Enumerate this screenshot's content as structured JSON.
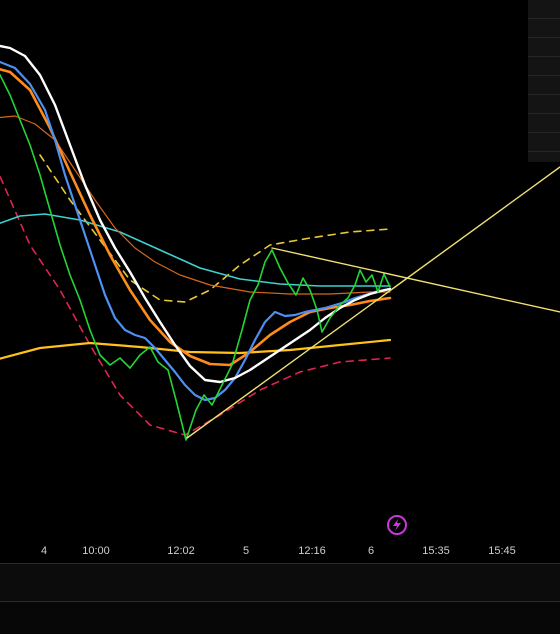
{
  "chart_data": {
    "type": "line",
    "x_tick_labels": [
      "4",
      "10:00",
      "12:02",
      "5",
      "12:16",
      "6",
      "15:35",
      "15:45"
    ],
    "colors": {
      "background": "#000000",
      "price": "#22d636",
      "fast_ma": "#4d8ff2",
      "ma_orange": "#ff8c1a",
      "ma_white": "#ffffff",
      "ma_cyan": "#3fd0d0",
      "ma_thin_orange": "#d8661a",
      "ma_yellow": "#ffc21a",
      "band_upper": "#e6c832",
      "band_lower": "#e02450",
      "trendline": "#f0e070"
    },
    "series": [
      {
        "key": "band_lower",
        "style": "dashed",
        "points": [
          [
            -5,
            165
          ],
          [
            30,
            245
          ],
          [
            60,
            290
          ],
          [
            90,
            345
          ],
          [
            120,
            395
          ],
          [
            150,
            425
          ],
          [
            185,
            435
          ],
          [
            220,
            415
          ],
          [
            260,
            390
          ],
          [
            300,
            372
          ],
          [
            340,
            362
          ],
          [
            390,
            358
          ]
        ]
      },
      {
        "key": "band_upper",
        "style": "dashed",
        "points": [
          [
            40,
            155
          ],
          [
            70,
            200
          ],
          [
            100,
            240
          ],
          [
            130,
            280
          ],
          [
            160,
            300
          ],
          [
            185,
            302
          ],
          [
            210,
            290
          ],
          [
            240,
            265
          ],
          [
            270,
            245
          ],
          [
            310,
            238
          ],
          [
            350,
            232
          ],
          [
            390,
            229
          ]
        ]
      },
      {
        "key": "ma_cyan",
        "style": "solid",
        "points": [
          [
            -5,
            225
          ],
          [
            20,
            216
          ],
          [
            45,
            214
          ],
          [
            80,
            220
          ],
          [
            120,
            232
          ],
          [
            160,
            250
          ],
          [
            200,
            268
          ],
          [
            240,
            279
          ],
          [
            280,
            284
          ],
          [
            320,
            286
          ],
          [
            360,
            286
          ],
          [
            390,
            286
          ]
        ]
      },
      {
        "key": "ma_thin_orange",
        "style": "solid",
        "points": [
          [
            -5,
            118
          ],
          [
            15,
            116
          ],
          [
            35,
            124
          ],
          [
            55,
            140
          ],
          [
            75,
            170
          ],
          [
            95,
            200
          ],
          [
            115,
            228
          ],
          [
            135,
            248
          ],
          [
            155,
            262
          ],
          [
            180,
            275
          ],
          [
            210,
            285
          ],
          [
            250,
            292
          ],
          [
            290,
            294
          ],
          [
            330,
            294
          ],
          [
            370,
            292
          ],
          [
            390,
            292
          ]
        ]
      },
      {
        "key": "ma_yellow",
        "style": "solid",
        "points": [
          [
            -5,
            360
          ],
          [
            40,
            348
          ],
          [
            90,
            343
          ],
          [
            140,
            347
          ],
          [
            190,
            352
          ],
          [
            240,
            353
          ],
          [
            290,
            350
          ],
          [
            340,
            345
          ],
          [
            390,
            340
          ]
        ]
      },
      {
        "key": "ma_orange",
        "style": "solid",
        "points": [
          [
            -5,
            68
          ],
          [
            10,
            72
          ],
          [
            30,
            90
          ],
          [
            50,
            128
          ],
          [
            70,
            172
          ],
          [
            90,
            215
          ],
          [
            110,
            255
          ],
          [
            130,
            290
          ],
          [
            150,
            320
          ],
          [
            170,
            342
          ],
          [
            190,
            356
          ],
          [
            210,
            364
          ],
          [
            230,
            365
          ],
          [
            250,
            352
          ],
          [
            270,
            335
          ],
          [
            290,
            322
          ],
          [
            310,
            312
          ],
          [
            330,
            308
          ],
          [
            350,
            305
          ],
          [
            370,
            301
          ],
          [
            390,
            298
          ]
        ]
      },
      {
        "key": "fast_ma",
        "style": "solid",
        "points": [
          [
            -5,
            60
          ],
          [
            15,
            68
          ],
          [
            30,
            84
          ],
          [
            45,
            110
          ],
          [
            55,
            140
          ],
          [
            65,
            175
          ],
          [
            75,
            205
          ],
          [
            85,
            235
          ],
          [
            95,
            265
          ],
          [
            105,
            295
          ],
          [
            115,
            318
          ],
          [
            125,
            330
          ],
          [
            135,
            335
          ],
          [
            145,
            338
          ],
          [
            155,
            348
          ],
          [
            165,
            360
          ],
          [
            175,
            372
          ],
          [
            185,
            385
          ],
          [
            195,
            395
          ],
          [
            205,
            400
          ],
          [
            215,
            398
          ],
          [
            225,
            390
          ],
          [
            235,
            378
          ],
          [
            245,
            360
          ],
          [
            255,
            340
          ],
          [
            265,
            322
          ],
          [
            275,
            312
          ],
          [
            285,
            316
          ],
          [
            295,
            315
          ],
          [
            305,
            312
          ],
          [
            315,
            310
          ],
          [
            325,
            308
          ],
          [
            335,
            305
          ],
          [
            345,
            302
          ],
          [
            355,
            298
          ],
          [
            365,
            295
          ],
          [
            375,
            292
          ],
          [
            385,
            290
          ],
          [
            390,
            289
          ]
        ]
      },
      {
        "key": "ma_white",
        "style": "solid",
        "points": [
          [
            -5,
            45
          ],
          [
            10,
            48
          ],
          [
            25,
            56
          ],
          [
            40,
            75
          ],
          [
            55,
            105
          ],
          [
            70,
            145
          ],
          [
            85,
            185
          ],
          [
            100,
            220
          ],
          [
            115,
            248
          ],
          [
            130,
            272
          ],
          [
            145,
            298
          ],
          [
            160,
            322
          ],
          [
            175,
            345
          ],
          [
            190,
            366
          ],
          [
            205,
            380
          ],
          [
            220,
            382
          ],
          [
            235,
            378
          ],
          [
            250,
            370
          ],
          [
            265,
            360
          ],
          [
            280,
            350
          ],
          [
            295,
            340
          ],
          [
            310,
            330
          ],
          [
            325,
            318
          ],
          [
            340,
            308
          ],
          [
            355,
            300
          ],
          [
            370,
            294
          ],
          [
            385,
            290
          ],
          [
            390,
            289
          ]
        ]
      },
      {
        "key": "price",
        "style": "solid",
        "points": [
          [
            -5,
            65
          ],
          [
            10,
            95
          ],
          [
            20,
            120
          ],
          [
            30,
            145
          ],
          [
            40,
            175
          ],
          [
            50,
            210
          ],
          [
            60,
            245
          ],
          [
            70,
            275
          ],
          [
            80,
            300
          ],
          [
            90,
            330
          ],
          [
            100,
            355
          ],
          [
            110,
            365
          ],
          [
            120,
            358
          ],
          [
            130,
            368
          ],
          [
            140,
            355
          ],
          [
            150,
            347
          ],
          [
            158,
            362
          ],
          [
            168,
            370
          ],
          [
            176,
            400
          ],
          [
            186,
            440
          ],
          [
            196,
            410
          ],
          [
            204,
            395
          ],
          [
            212,
            405
          ],
          [
            222,
            385
          ],
          [
            232,
            365
          ],
          [
            242,
            330
          ],
          [
            250,
            300
          ],
          [
            258,
            285
          ],
          [
            265,
            262
          ],
          [
            272,
            250
          ],
          [
            280,
            268
          ],
          [
            288,
            283
          ],
          [
            296,
            295
          ],
          [
            303,
            278
          ],
          [
            310,
            290
          ],
          [
            317,
            310
          ],
          [
            322,
            332
          ],
          [
            330,
            318
          ],
          [
            340,
            305
          ],
          [
            348,
            298
          ],
          [
            355,
            285
          ],
          [
            360,
            270
          ],
          [
            366,
            282
          ],
          [
            372,
            275
          ],
          [
            378,
            292
          ],
          [
            384,
            274
          ],
          [
            390,
            287
          ]
        ]
      },
      {
        "key": "trendline",
        "style": "solid",
        "points": [
          [
            187,
            438
          ],
          [
            395,
            287
          ],
          [
            560,
            167
          ]
        ]
      },
      {
        "key": "trendline",
        "style": "solid",
        "points": [
          [
            272,
            248
          ],
          [
            560,
            312
          ]
        ]
      }
    ]
  }
}
